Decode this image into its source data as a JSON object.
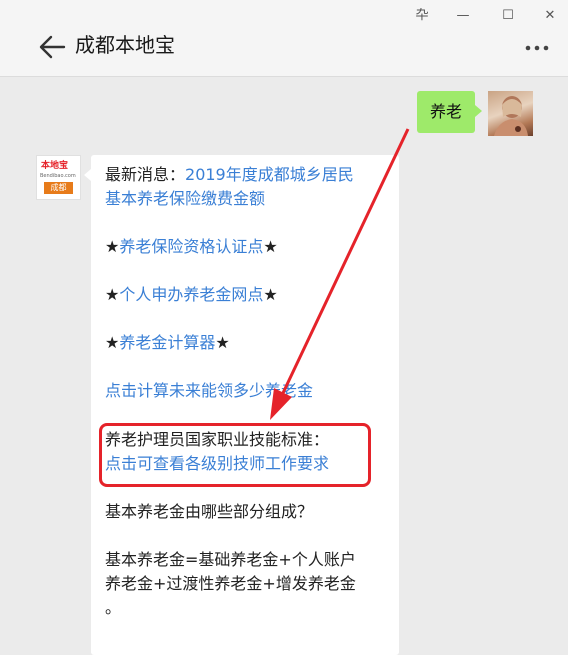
{
  "window": {
    "pin_glyph": "卆",
    "minimize_glyph": "—",
    "maximize_glyph": "☐",
    "close_glyph": "✕"
  },
  "header": {
    "title": "成都本地宝"
  },
  "user_message": {
    "text": "养老"
  },
  "bot_avatar": {
    "brand_top": "本地宝",
    "brand_url": "Bendibao.com",
    "brand_city": "成都"
  },
  "bot_message": {
    "line1_prefix": "最新消息：",
    "line1_link": "2019年度成都城乡居民",
    "line2_link": "基本养老保险缴费金额",
    "item1_star_left": "★",
    "item1_link": "养老保险资格认证点",
    "item1_star_right": "★",
    "item2_star_left": "★",
    "item2_link": "个人申办养老金网点",
    "item2_star_right": "★",
    "item3_star_left": "★",
    "item3_link": "养老金计算器",
    "item3_star_right": "★",
    "calc_link": "点击计算未来能领多少养老金",
    "standard_text": "养老护理员国家职业技能标准：",
    "standard_link": "点击可查看各级别技师工作要求",
    "question": "基本养老金由哪些部分组成？",
    "formula_line1": "基本养老金=基础养老金+个人账户",
    "formula_line2": "养老金+过渡性养老金+增发养老金",
    "formula_line3": "。"
  },
  "colors": {
    "link": "#3a7fd5",
    "user_bubble": "#9eea6a",
    "highlight": "#e5232a"
  }
}
